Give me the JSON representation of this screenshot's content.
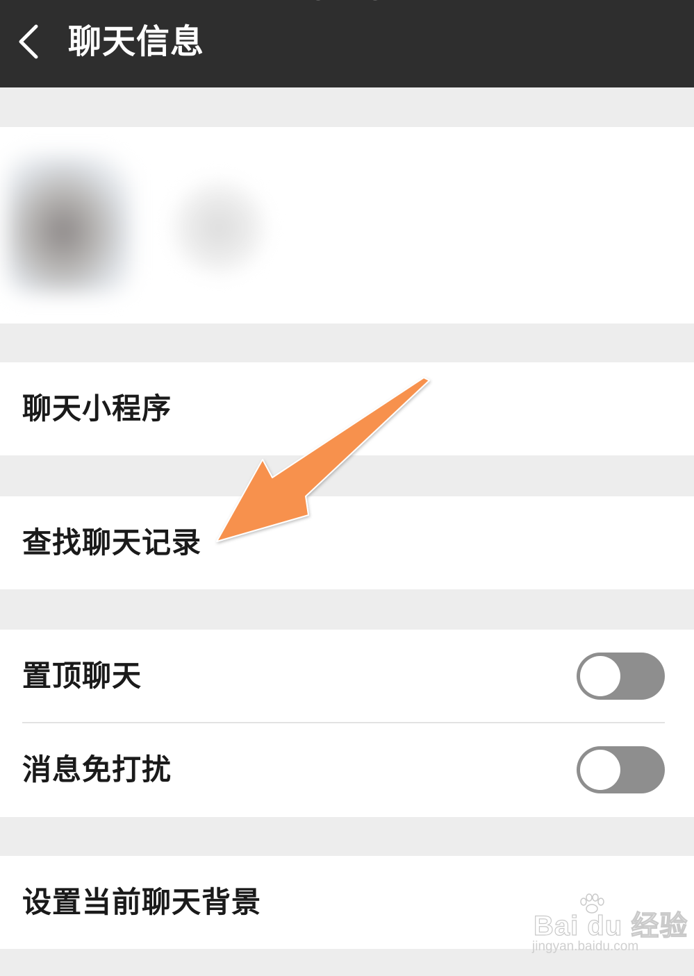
{
  "header": {
    "title": "聊天信息",
    "background": "#2e2e2e"
  },
  "rows": {
    "mini_programs": "聊天小程序",
    "search_history": "查找聊天记录",
    "sticky_chat": "置顶聊天",
    "mute_notifications": "消息免打扰",
    "set_background": "设置当前聊天背景"
  },
  "toggles": {
    "sticky_chat_on": false,
    "mute_notifications_on": false,
    "track_color": "#8e8e8e"
  },
  "annotation": {
    "arrow_color": "#f7914d"
  },
  "watermark": {
    "logo_text": "Bai du 经验",
    "url": "jingyan.baidu.com"
  }
}
